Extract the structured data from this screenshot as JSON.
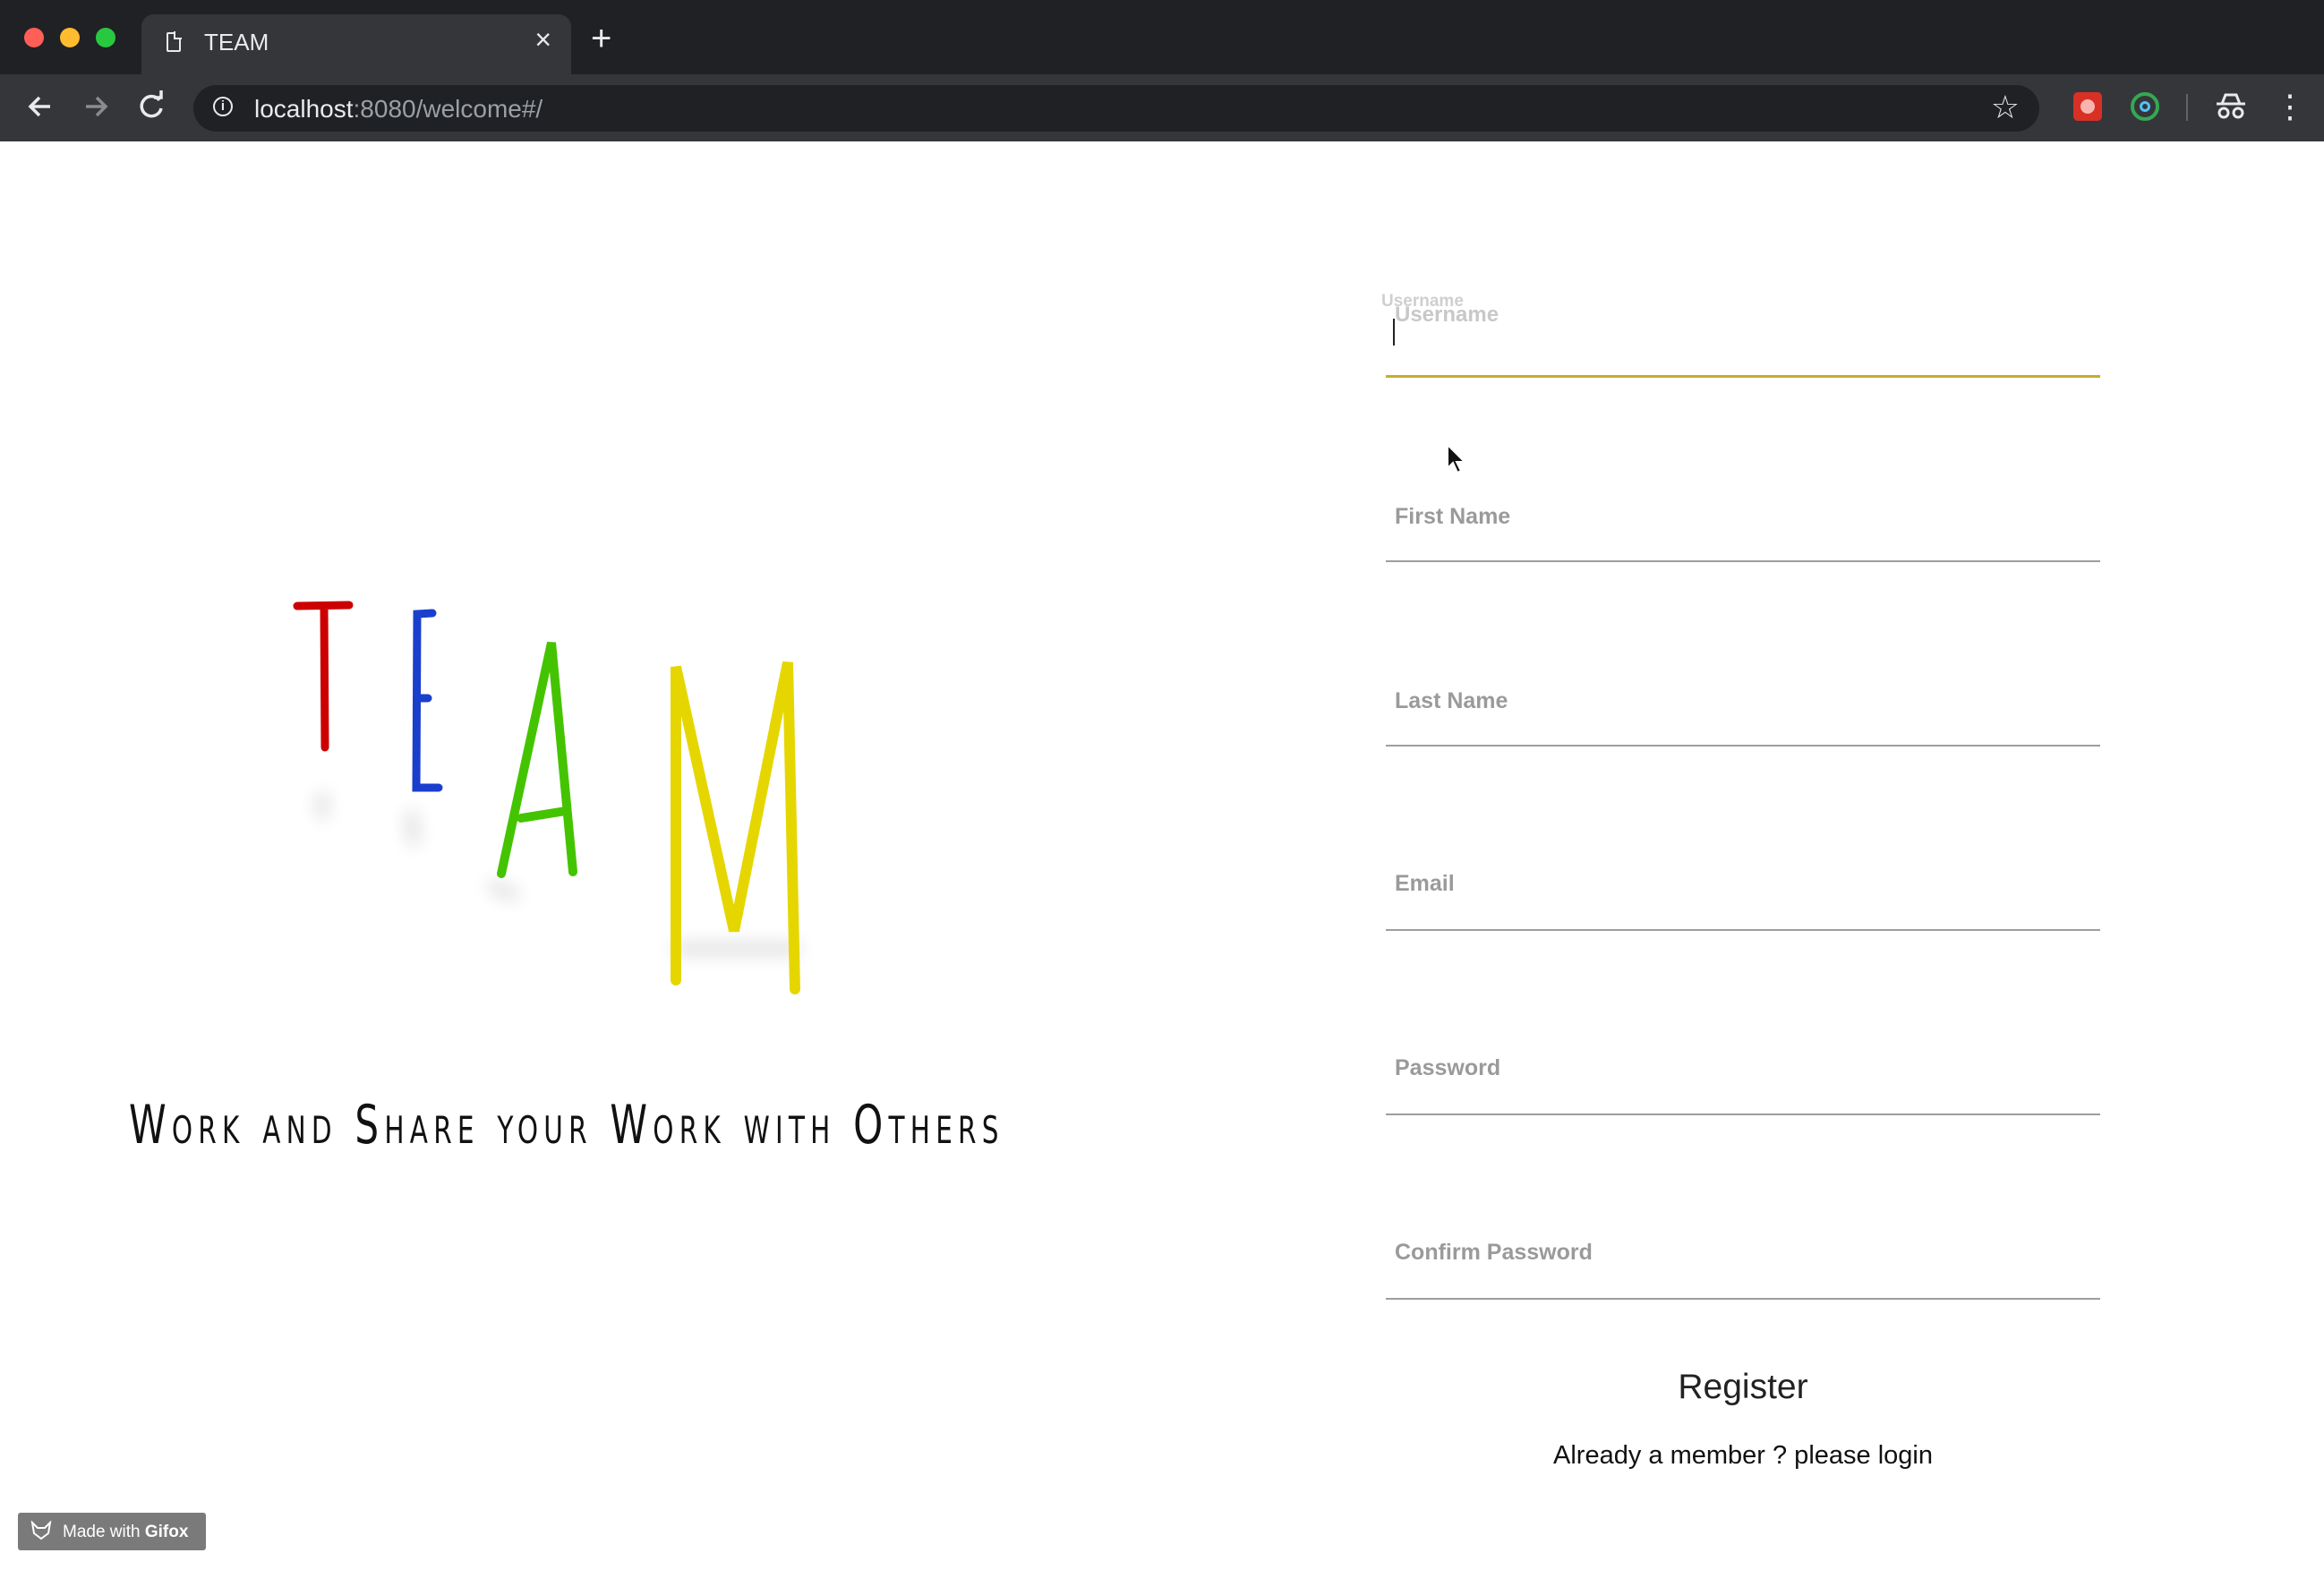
{
  "browser": {
    "tab_title": "TEAM",
    "close_glyph": "×",
    "new_tab_glyph": "+",
    "url_host": "localhost",
    "url_rest": ":8080/welcome#/",
    "icons": [
      "page-icon",
      "close-icon",
      "plus-icon",
      "back-icon",
      "forward-icon",
      "reload-icon",
      "info-icon",
      "star-icon",
      "extension-icon",
      "extension-icon",
      "incognito-icon",
      "menu-icon"
    ]
  },
  "logo": {
    "letters": [
      {
        "char": "T",
        "color": "#cc0000"
      },
      {
        "char": "E",
        "color": "#1a3fcc"
      },
      {
        "char": "A",
        "color": "#44c400"
      },
      {
        "char": "M",
        "color": "#e6d600"
      }
    ],
    "tagline": "Work and Share your Work with Others"
  },
  "form": {
    "username_label": "Username",
    "first_name_label": "First Name",
    "last_name_label": "Last Name",
    "email_label": "Email",
    "password_label": "Password",
    "confirm_password_label": "Confirm Password",
    "focus_color": "#c8ad2c",
    "register_label": "Register",
    "login_prompt": "Already a member ? please login"
  },
  "badge": {
    "made_with": "Made with ",
    "brand": "Gifox"
  }
}
